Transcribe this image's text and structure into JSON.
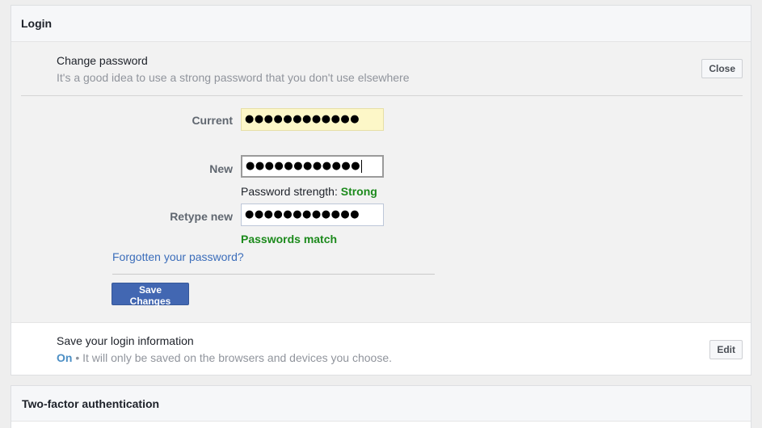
{
  "login": {
    "header": "Login",
    "change_password": {
      "title": "Change password",
      "description": "It's a good idea to use a strong password that you don't use elsewhere",
      "close_label": "Close",
      "current_label": "Current",
      "current_value": "●●●●●●●●●●●●",
      "new_label": "New",
      "new_value": "●●●●●●●●●●●●",
      "strength_label": "Password strength: ",
      "strength_value": "Strong",
      "retype_label": "Retype new",
      "retype_value": "●●●●●●●●●●●●",
      "match_text": "Passwords match",
      "forgot_link": "Forgotten your password?",
      "save_label": "Save Changes"
    },
    "save_login": {
      "title": "Save your login information",
      "status": "On",
      "description": " • It will only be saved on the browsers and devices you choose.",
      "edit_label": "Edit"
    }
  },
  "two_factor": {
    "header": "Two-factor authentication"
  },
  "colors": {
    "accent": "#4267b2",
    "success": "#1c8a1c",
    "link": "#3b6dba",
    "autofill": "#fdf7c8"
  }
}
